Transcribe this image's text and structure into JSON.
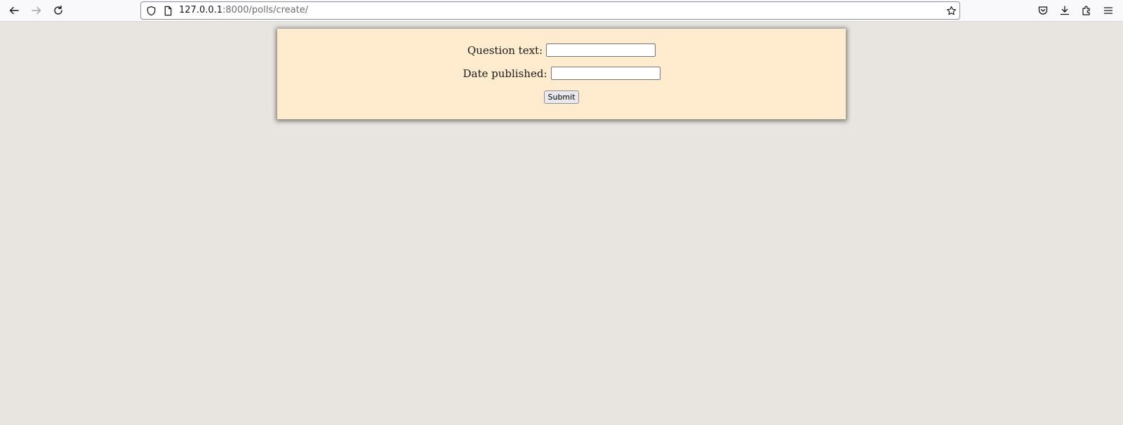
{
  "browser": {
    "url_host": "127.0.0.1",
    "url_rest": ":8000/polls/create/"
  },
  "form": {
    "question_label": "Question text:",
    "question_value": "",
    "date_label": "Date published:",
    "date_value": "",
    "submit_label": "Submit"
  },
  "colors": {
    "page_bg": "#e8e4df",
    "panel_bg": "#ffebcd"
  }
}
